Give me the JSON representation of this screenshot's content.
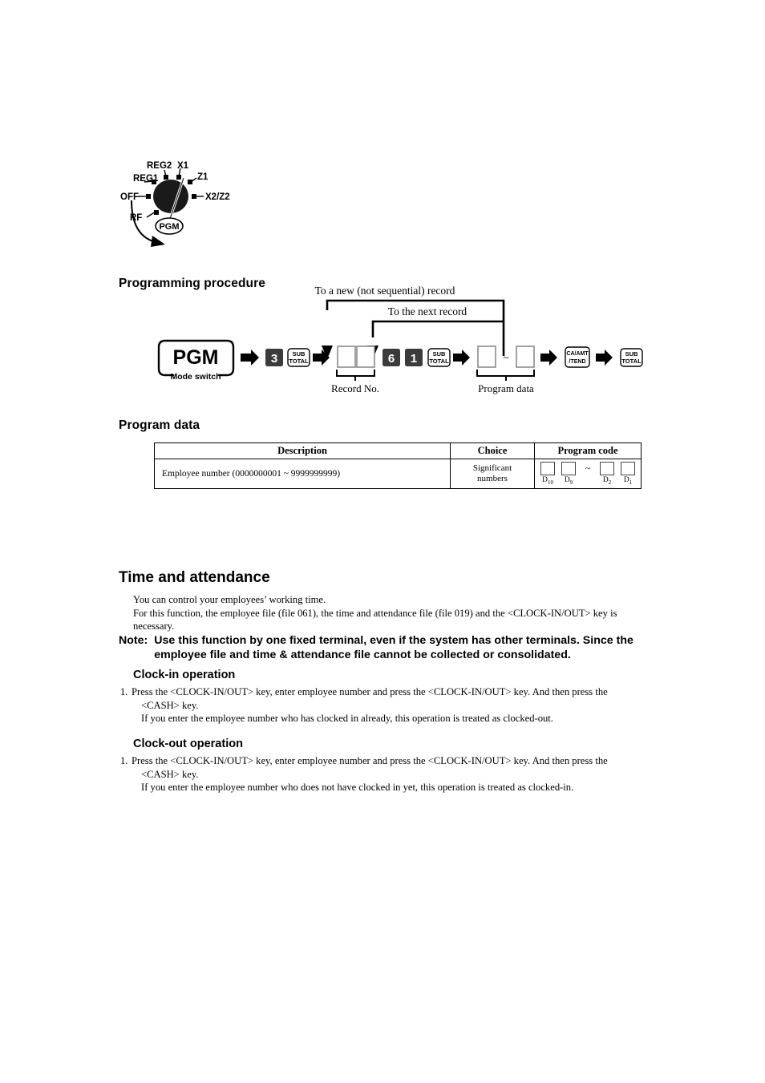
{
  "mode_dial": {
    "name": "mode-switch-dial",
    "labels": [
      "REG2",
      "X1",
      "REG1",
      "Z1",
      "OFF",
      "X2/Z2",
      "RF",
      "PGM"
    ],
    "selected": "PGM"
  },
  "sections": {
    "programming_procedure": "Programming procedure",
    "program_data": "Program data",
    "time_and_attendance": "Time and attendance",
    "clock_in_operation": "Clock-in operation",
    "clock_out_operation": "Clock-out operation"
  },
  "flow": {
    "mode_box_label": "PGM",
    "mode_box_caption": "Mode switch",
    "key_3": "3",
    "key_subtotal_line1": "SUB",
    "key_subtotal_line2": "TOTAL",
    "key_6": "6",
    "key_1": "1",
    "key_cash_line1": "CA/AMT",
    "key_cash_line2": "/TEND",
    "record_no_caption": "Record No.",
    "program_data_caption": "Program data",
    "tilde": "~",
    "loop_new_record": "To a new (not sequential) record",
    "loop_next_record": "To the next record"
  },
  "program_data_table": {
    "headers": [
      "Description",
      "Choice",
      "Program code"
    ],
    "rows": [
      {
        "description": "Employee number (0000000001 ~ 9999999999)",
        "choice_line1": "Significant",
        "choice_line2": "numbers",
        "code_labels": [
          "D10",
          "D9",
          "D2",
          "D1"
        ],
        "code_tilde": "~"
      }
    ]
  },
  "time_and_attendance": {
    "intro_line1": "You can control your employees’ working time.",
    "intro_line2": "For this function, the employee file (file 061), the time and attendance file (file 019) and the <CLOCK-IN/OUT> key is",
    "intro_line3": "necessary.",
    "note_label": "Note:",
    "note_line1": "Use this function by one fixed terminal, even if the system has other terminals. Since the",
    "note_line2": "employee file and time & attendance file cannot be collected or consolidated."
  },
  "clock_in": {
    "step_number": "1.",
    "step_line1": "Press the <CLOCK-IN/OUT> key, enter employee number and press the <CLOCK-IN/OUT> key. And then press the",
    "step_line2": "<CASH> key.",
    "step_line3": "If you enter the employee number who has clocked in already, this operation is treated as clocked-out."
  },
  "clock_out": {
    "step_number": "1.",
    "step_line1": "Press the <CLOCK-IN/OUT> key, enter employee number and press the <CLOCK-IN/OUT> key. And then press the",
    "step_line2": "<CASH> key.",
    "step_line3": "If you enter the employee number who does not have clocked in yet, this operation is treated as clocked-in."
  }
}
